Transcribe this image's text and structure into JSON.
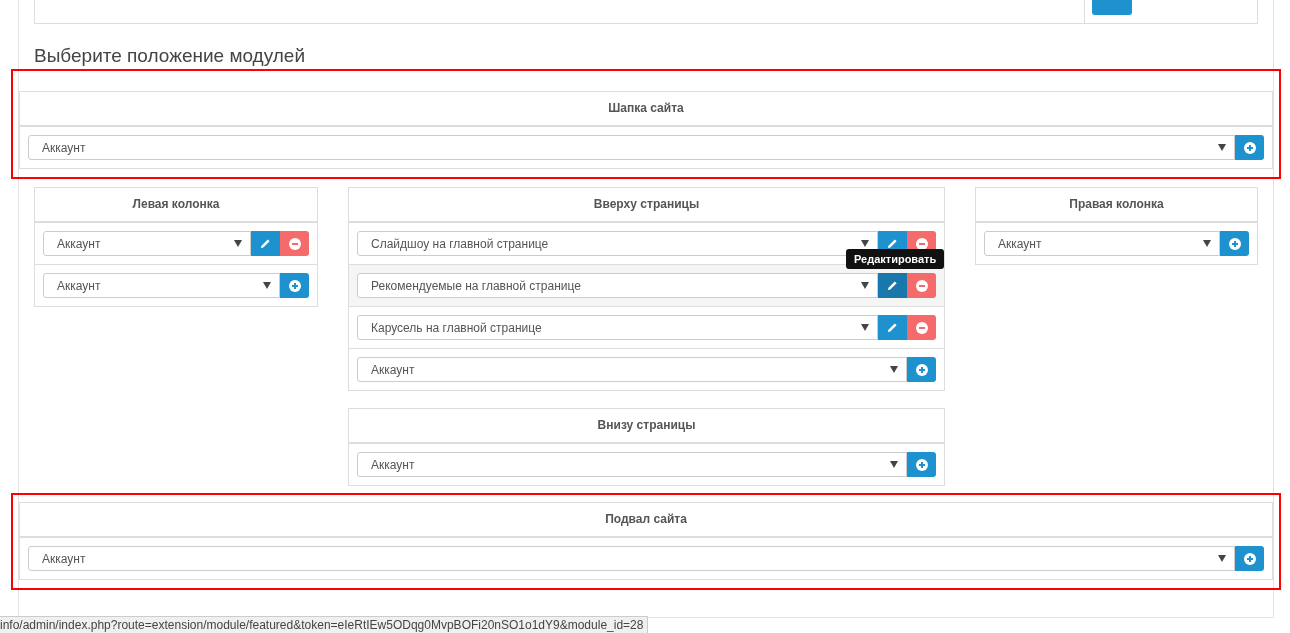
{
  "section_title": "Выберите положение модулей",
  "header": {
    "title": "Шапка сайта",
    "highlighted": true,
    "rows": [
      {
        "kind": "add",
        "value": "Аккаунт"
      }
    ]
  },
  "columns": [
    {
      "cards": [
        {
          "title": "Левая колонка",
          "rows": [
            {
              "kind": "module",
              "value": "Аккаунт"
            },
            {
              "kind": "add",
              "value": "Аккаунт"
            }
          ]
        }
      ]
    },
    {
      "cards": [
        {
          "title": "Вверху страницы",
          "rows": [
            {
              "kind": "module",
              "value": "Слайдшоу на главной странице"
            },
            {
              "kind": "module",
              "value": "Рекомендуемые на главной странице",
              "tooltip": "Редактировать"
            },
            {
              "kind": "module",
              "value": "Карусель на главной странице"
            },
            {
              "kind": "add",
              "value": "Аккаунт"
            }
          ]
        },
        {
          "title": "Внизу страницы",
          "rows": [
            {
              "kind": "add",
              "value": "Аккаунт"
            }
          ]
        }
      ]
    },
    {
      "cards": [
        {
          "title": "Правая колонка",
          "rows": [
            {
              "kind": "add",
              "value": "Аккаунт"
            }
          ]
        }
      ]
    }
  ],
  "footer": {
    "title": "Подвал сайта",
    "highlighted": true,
    "rows": [
      {
        "kind": "add",
        "value": "Аккаунт"
      }
    ]
  },
  "status_bar": "info/admin/index.php?route=extension/module/featured&token=eIeRtIEw5ODqg0MvpBOFi20nSO1o1dY9&module_id=28"
}
